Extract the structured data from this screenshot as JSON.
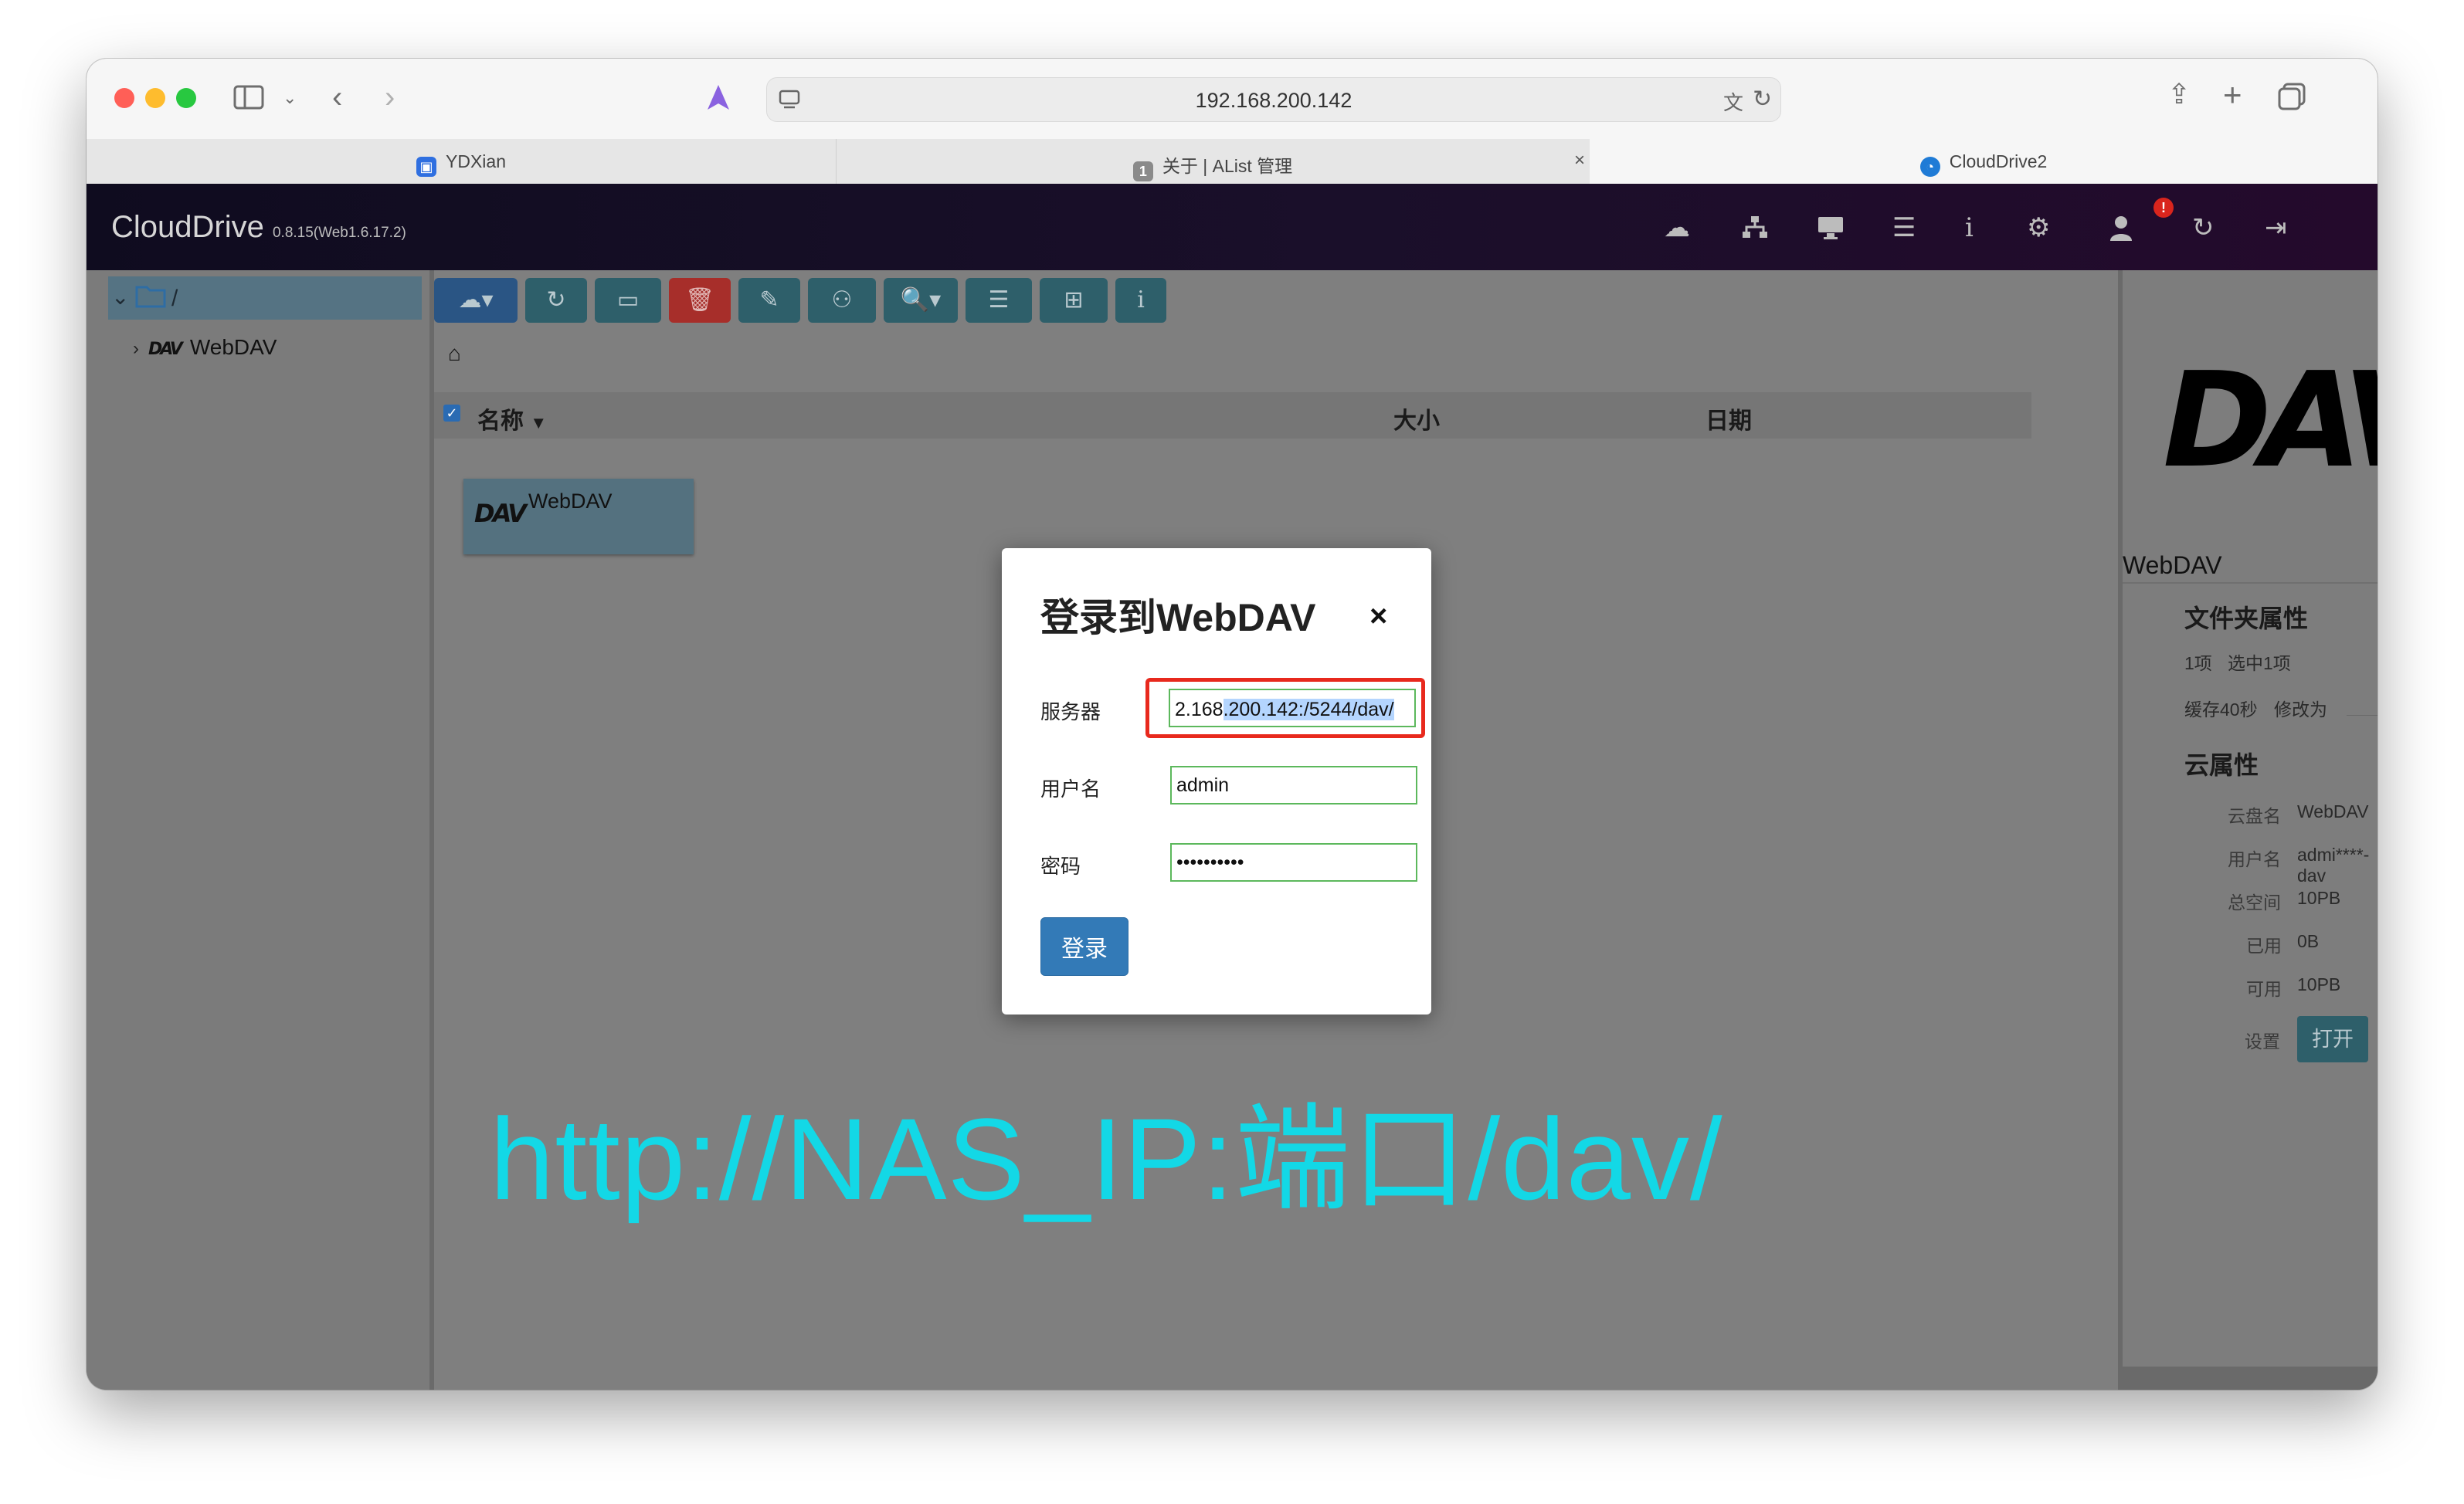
{
  "browser": {
    "url": "192.168.200.142",
    "tabs": [
      {
        "label": "YDXian",
        "icon": "ydxian-favicon"
      },
      {
        "label": "关于 | AList 管理",
        "icon": "alist-favicon",
        "badge": "1"
      },
      {
        "label": "CloudDrive2",
        "icon": "clouddrive-favicon"
      }
    ]
  },
  "app": {
    "brand": "CloudDrive",
    "version": "0.8.15(Web1.6.17.2)",
    "nav_icons": [
      "cloud-upload-icon",
      "network-icon",
      "desktop-icon",
      "tasks-icon",
      "info-icon",
      "settings-icon",
      "user-add-icon",
      "refresh-icon",
      "logout-icon"
    ],
    "nav_badge": "!"
  },
  "tree": {
    "root": "/",
    "items": [
      {
        "label": "WebDAV",
        "logo": "DAV"
      }
    ]
  },
  "breadcrumb_icon": "home-icon",
  "list": {
    "columns": {
      "name": "名称",
      "size": "大小",
      "date": "日期"
    },
    "items": [
      {
        "label": "WebDAV",
        "logo": "DAV"
      }
    ]
  },
  "details": {
    "logo": "DAV",
    "name": "WebDAV",
    "folder_props_title": "文件夹属性",
    "items_count": "1项",
    "selected_count": "选中1项",
    "cache_label": "缓存40秒",
    "modify_label": "修改为",
    "seconds_unit": "秒",
    "cloud_props_title": "云属性",
    "rows": [
      {
        "label": "云盘名",
        "value": "WebDAV"
      },
      {
        "label": "用户名",
        "value": "admi****-dav"
      },
      {
        "label": "总空间",
        "value": "10PB"
      },
      {
        "label": "已用",
        "value": "0B"
      },
      {
        "label": "可用",
        "value": "10PB"
      }
    ],
    "settings_label": "设置",
    "open_button": "打开"
  },
  "modal": {
    "title": "登录到WebDAV",
    "close": "×",
    "server_label": "服务器",
    "server_value_start": "2.168",
    "server_value_selected": ".200.142:/5244/dav/",
    "username_label": "用户名",
    "username_value": "admin",
    "password_label": "密码",
    "password_value": "••••••••••",
    "login_button": "登录"
  },
  "watermark": "http://NAS_IP:端口/dav/",
  "colors": {
    "accent_red": "#e8291d",
    "login_blue": "#337ab7",
    "watermark_cyan": "#13d8e6",
    "toolbar_teal": "#2e5f6a",
    "delete_red": "#a72e2a"
  }
}
